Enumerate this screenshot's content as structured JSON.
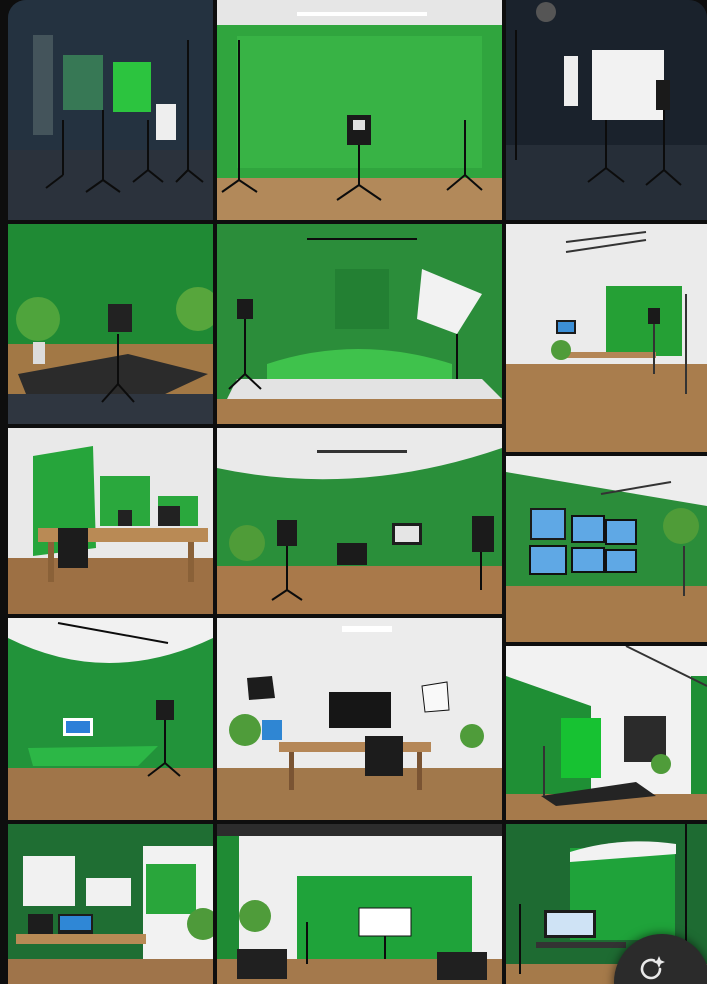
{
  "gallery": {
    "columns": [
      {
        "name": "left",
        "tiles": [
          {
            "scene": "dark-studio",
            "accent": "#2a7f3c"
          },
          {
            "scene": "green-cyclorama-rug",
            "accent": "#1f8a34"
          },
          {
            "scene": "green-office-desk",
            "accent": "#25923a"
          },
          {
            "scene": "green-cove-monitor",
            "accent": "#2c8c3b"
          },
          {
            "scene": "green-wall-workstation",
            "accent": "#1e6e33"
          }
        ]
      },
      {
        "name": "middle",
        "tiles": [
          {
            "scene": "green-cyclorama-tripods",
            "accent": "#33a43f"
          },
          {
            "scene": "green-softbox-set",
            "accent": "#2b8d3a"
          },
          {
            "scene": "green-curved-equipment",
            "accent": "#2a8f3a"
          },
          {
            "scene": "white-studio-desk",
            "accent": "#e6e6e6"
          },
          {
            "scene": "white-green-screen-chairs",
            "accent": "#1fa33a"
          }
        ]
      },
      {
        "name": "right",
        "tiles": [
          {
            "scene": "dark-white-screens",
            "accent": "#f2f2f2"
          },
          {
            "scene": "white-room-green-panel",
            "accent": "#25a035"
          },
          {
            "scene": "green-multi-monitor",
            "accent": "#2b8d3a"
          },
          {
            "scene": "green-white-split",
            "accent": "#17a82f"
          },
          {
            "scene": "green-screen-ring",
            "accent": "#1fa33a"
          }
        ]
      }
    ]
  },
  "fab": {
    "icon": "sparkle-refresh-icon"
  }
}
